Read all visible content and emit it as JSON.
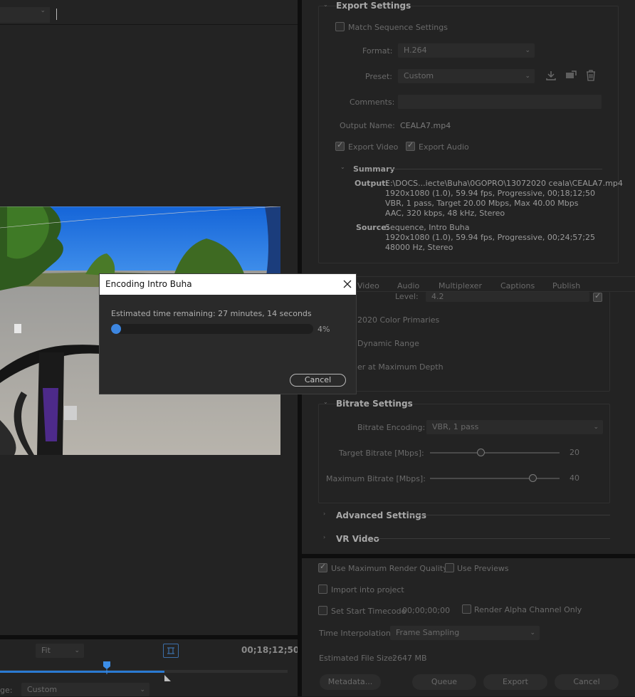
{
  "preview": {
    "fit_label": "Fit",
    "timecode": "00;18;12;50",
    "range_label": "ge:",
    "range_value": "Custom"
  },
  "export_settings": {
    "title": "Export Settings",
    "match_sequence": "Match Sequence Settings",
    "format_label": "Format:",
    "format_value": "H.264",
    "preset_label": "Preset:",
    "preset_value": "Custom",
    "comments_label": "Comments:",
    "output_name_label": "Output Name:",
    "output_name_value": "CEALA7.mp4",
    "export_video": "Export Video",
    "export_audio": "Export Audio"
  },
  "summary": {
    "title": "Summary",
    "output_label": "Output:",
    "output_lines": [
      "E:\\DOCS...iecte\\Buha\\0GOPRO\\13072020 ceala\\CEALA7.mp4",
      "1920x1080 (1.0), 59.94 fps, Progressive, 00;18;12;50",
      "VBR, 1 pass, Target 20.00 Mbps, Max 40.00 Mbps",
      "AAC, 320 kbps, 48 kHz, Stereo"
    ],
    "source_label": "Source:",
    "source_lines": [
      "Sequence, Intro Buha",
      "1920x1080 (1.0), 59.94 fps, Progressive, 00;24;57;25",
      "48000 Hz, Stereo"
    ]
  },
  "tabs": [
    "Video",
    "Audio",
    "Multiplexer",
    "Captions",
    "Publish"
  ],
  "video_partial": {
    "level_label": "Level:",
    "level_value": "4.2",
    "line1": "2020 Color Primaries",
    "line2": "Dynamic Range",
    "line3": "er at Maximum Depth"
  },
  "bitrate": {
    "title": "Bitrate Settings",
    "encoding_label": "Bitrate Encoding:",
    "encoding_value": "VBR, 1 pass",
    "target_label": "Target Bitrate [Mbps]:",
    "target_value": "20",
    "max_label": "Maximum Bitrate [Mbps]:",
    "max_value": "40"
  },
  "advanced": "Advanced Settings",
  "vr": "VR Video",
  "bottom": {
    "max_render": "Use Maximum Render Quality",
    "use_previews": "Use Previews",
    "import_project": "Import into project",
    "set_start_tc": "Set Start Timecode",
    "start_tc_value": "00;00;00;00",
    "render_alpha": "Render Alpha Channel Only",
    "time_interp_label": "Time Interpolation:",
    "time_interp_value": "Frame Sampling",
    "file_size_label": "Estimated File Size:",
    "file_size_value": "2647 MB",
    "metadata_btn": "Metadata...",
    "queue_btn": "Queue",
    "export_btn": "Export",
    "cancel_btn": "Cancel"
  },
  "dialog": {
    "title": "Encoding Intro Buha",
    "remaining": "Estimated time remaining: 27 minutes, 14 seconds",
    "percent": "4%",
    "progress": 0.04,
    "cancel": "Cancel"
  }
}
